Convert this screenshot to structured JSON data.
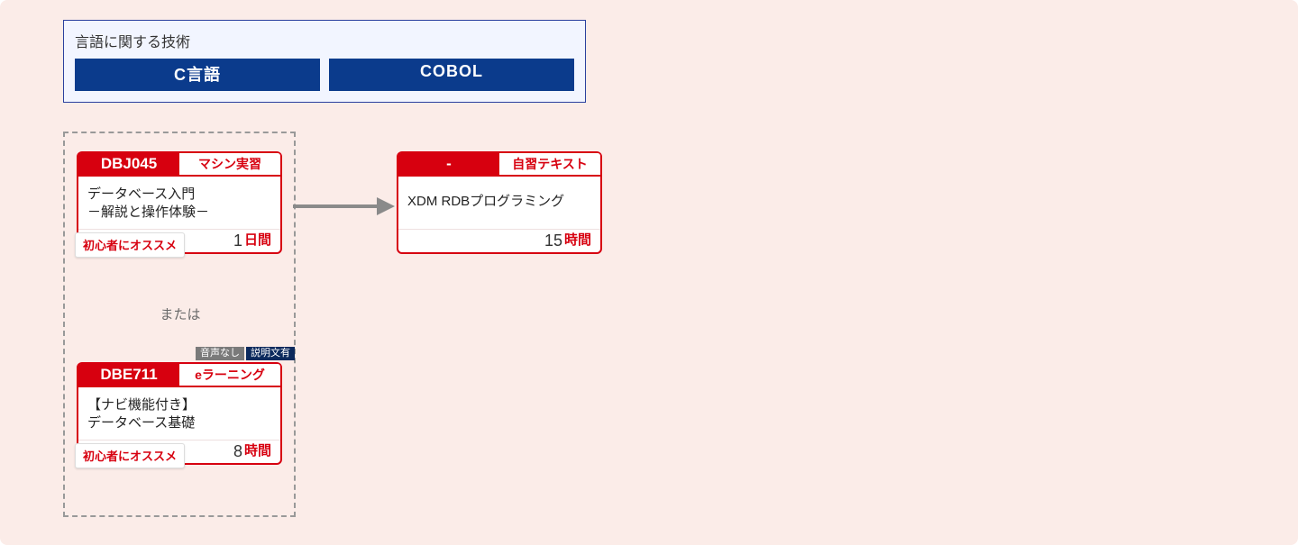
{
  "header": {
    "title": "言語に関する技術",
    "buttons": [
      "C言語",
      "COBOL"
    ]
  },
  "group": {
    "or_label": "または",
    "cards": [
      {
        "code": "DBJ045",
        "type_label": "マシン実習",
        "title_line1": "データベース入門",
        "title_line2": "－解説と操作体験－",
        "duration_num": "1",
        "duration_unit": "日間",
        "recommend": "初心者にオススメ"
      },
      {
        "code": "DBE711",
        "type_label": "eラーニング",
        "title_line1": "【ナビ機能付き】",
        "title_line2": "データベース基礎",
        "duration_num": "8",
        "duration_unit": "時間",
        "recommend": "初心者にオススメ",
        "pretags": [
          "音声なし",
          "説明文有"
        ]
      }
    ]
  },
  "right_card": {
    "code": "-",
    "type_label": "自習テキスト",
    "title_line1": "XDM RDBプログラミング",
    "duration_num": "15",
    "duration_unit": "時間"
  }
}
